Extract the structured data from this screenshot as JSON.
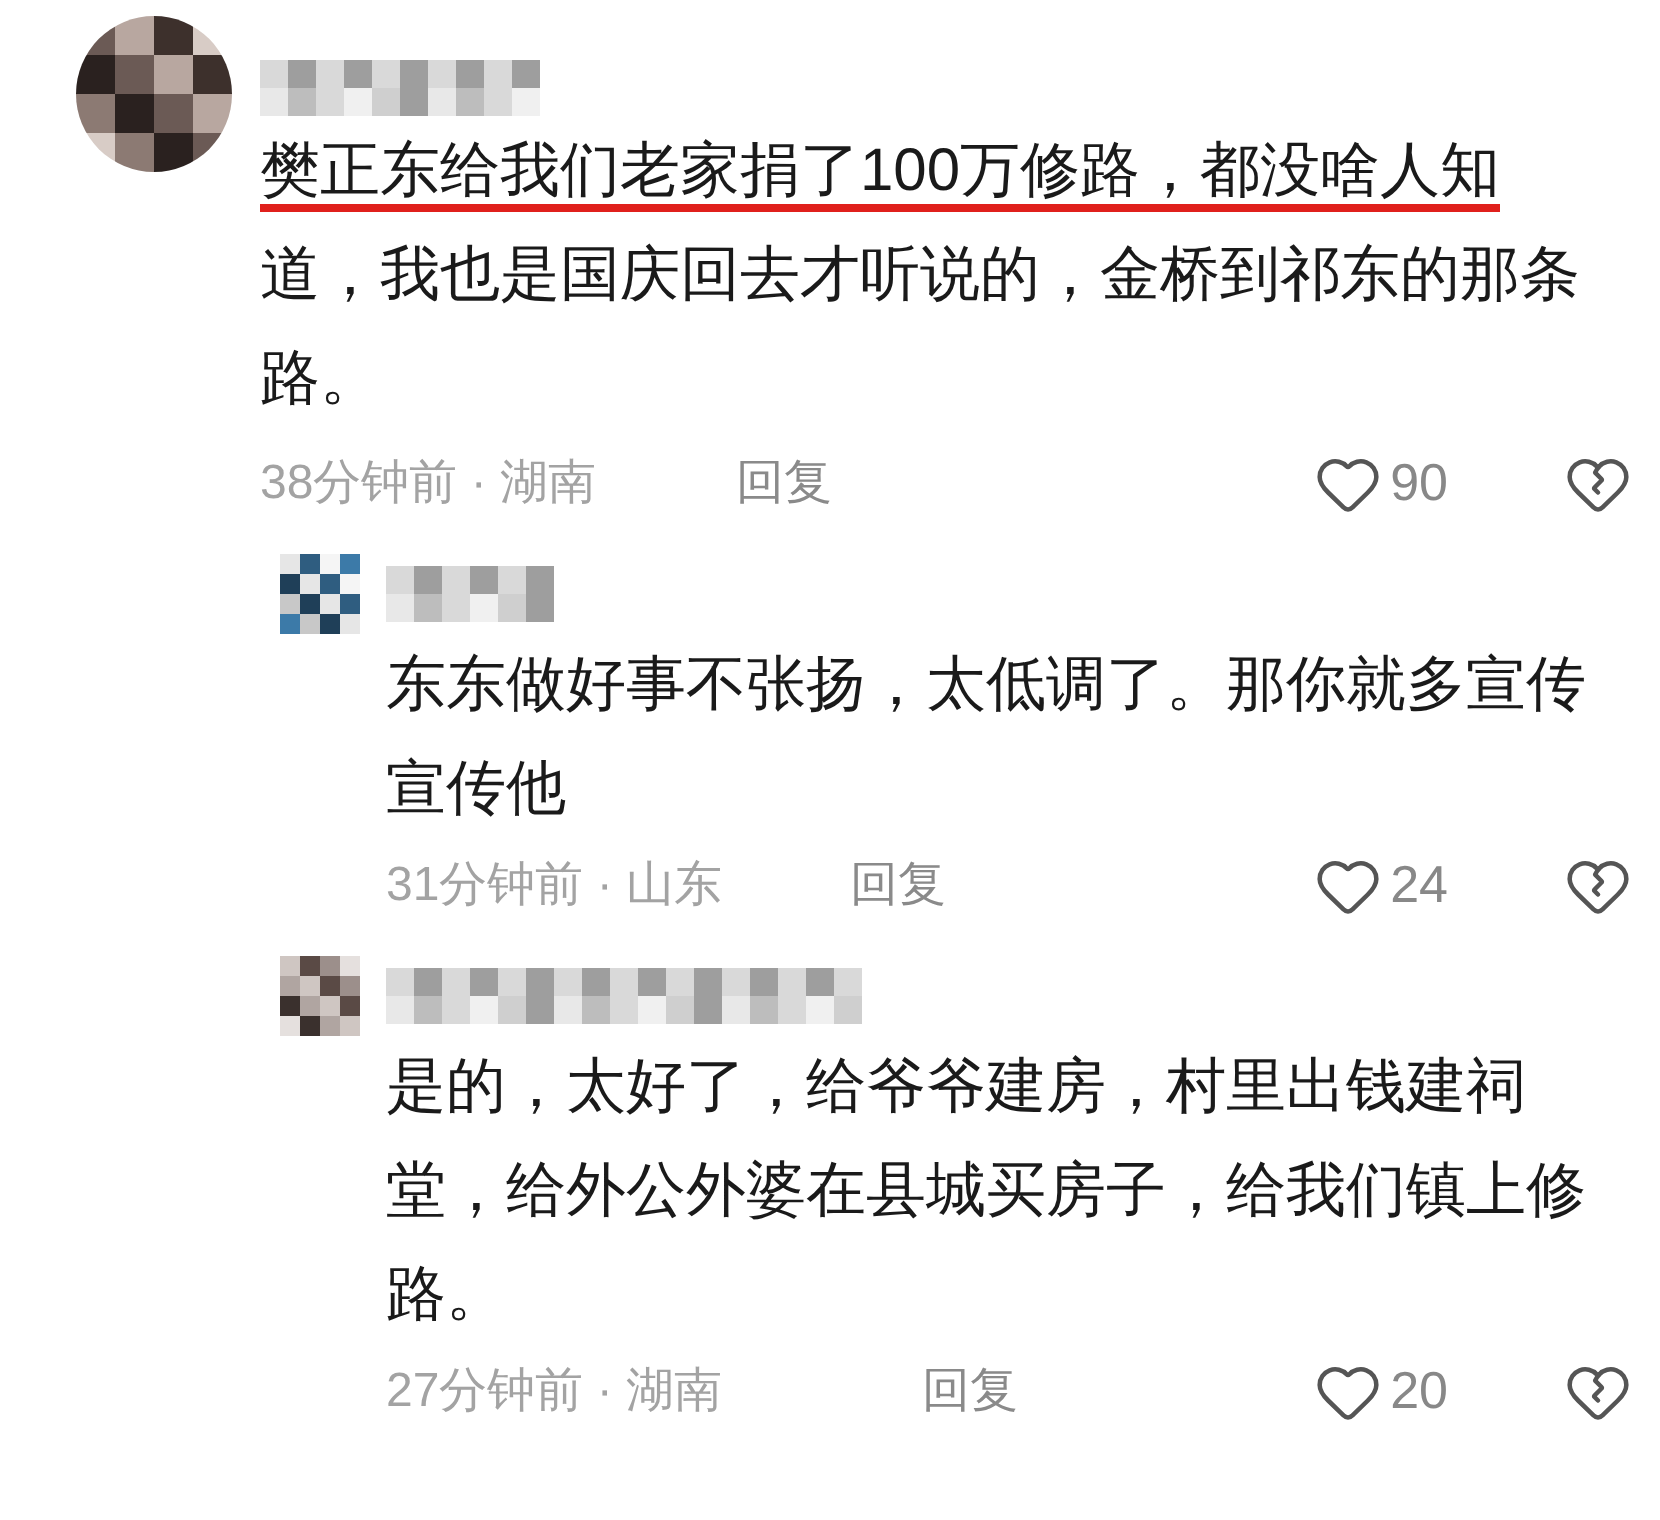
{
  "comment": {
    "underlined": "樊正东给我们老家捐了100万修路，都没啥人知",
    "text": "道，我也是国庆回去才听说的，金桥到祁东的那条路。",
    "meta": "38分钟前 · 湖南",
    "reply": "回复",
    "likes": "90",
    "liked": false,
    "replies": [
      {
        "text": "东东做好事不张扬，太低调了。那你就多宣传宣传他",
        "meta": "31分钟前 · 山东",
        "reply": "回复",
        "likes": "24",
        "liked": false
      },
      {
        "text": "是的，太好了，给爷爷建房，村里出钱建祠堂，给外公外婆在县城买房子，给我们镇上修路。",
        "meta": "27分钟前 · 湖南",
        "reply": "回复",
        "likes": "20",
        "liked": false
      }
    ]
  }
}
